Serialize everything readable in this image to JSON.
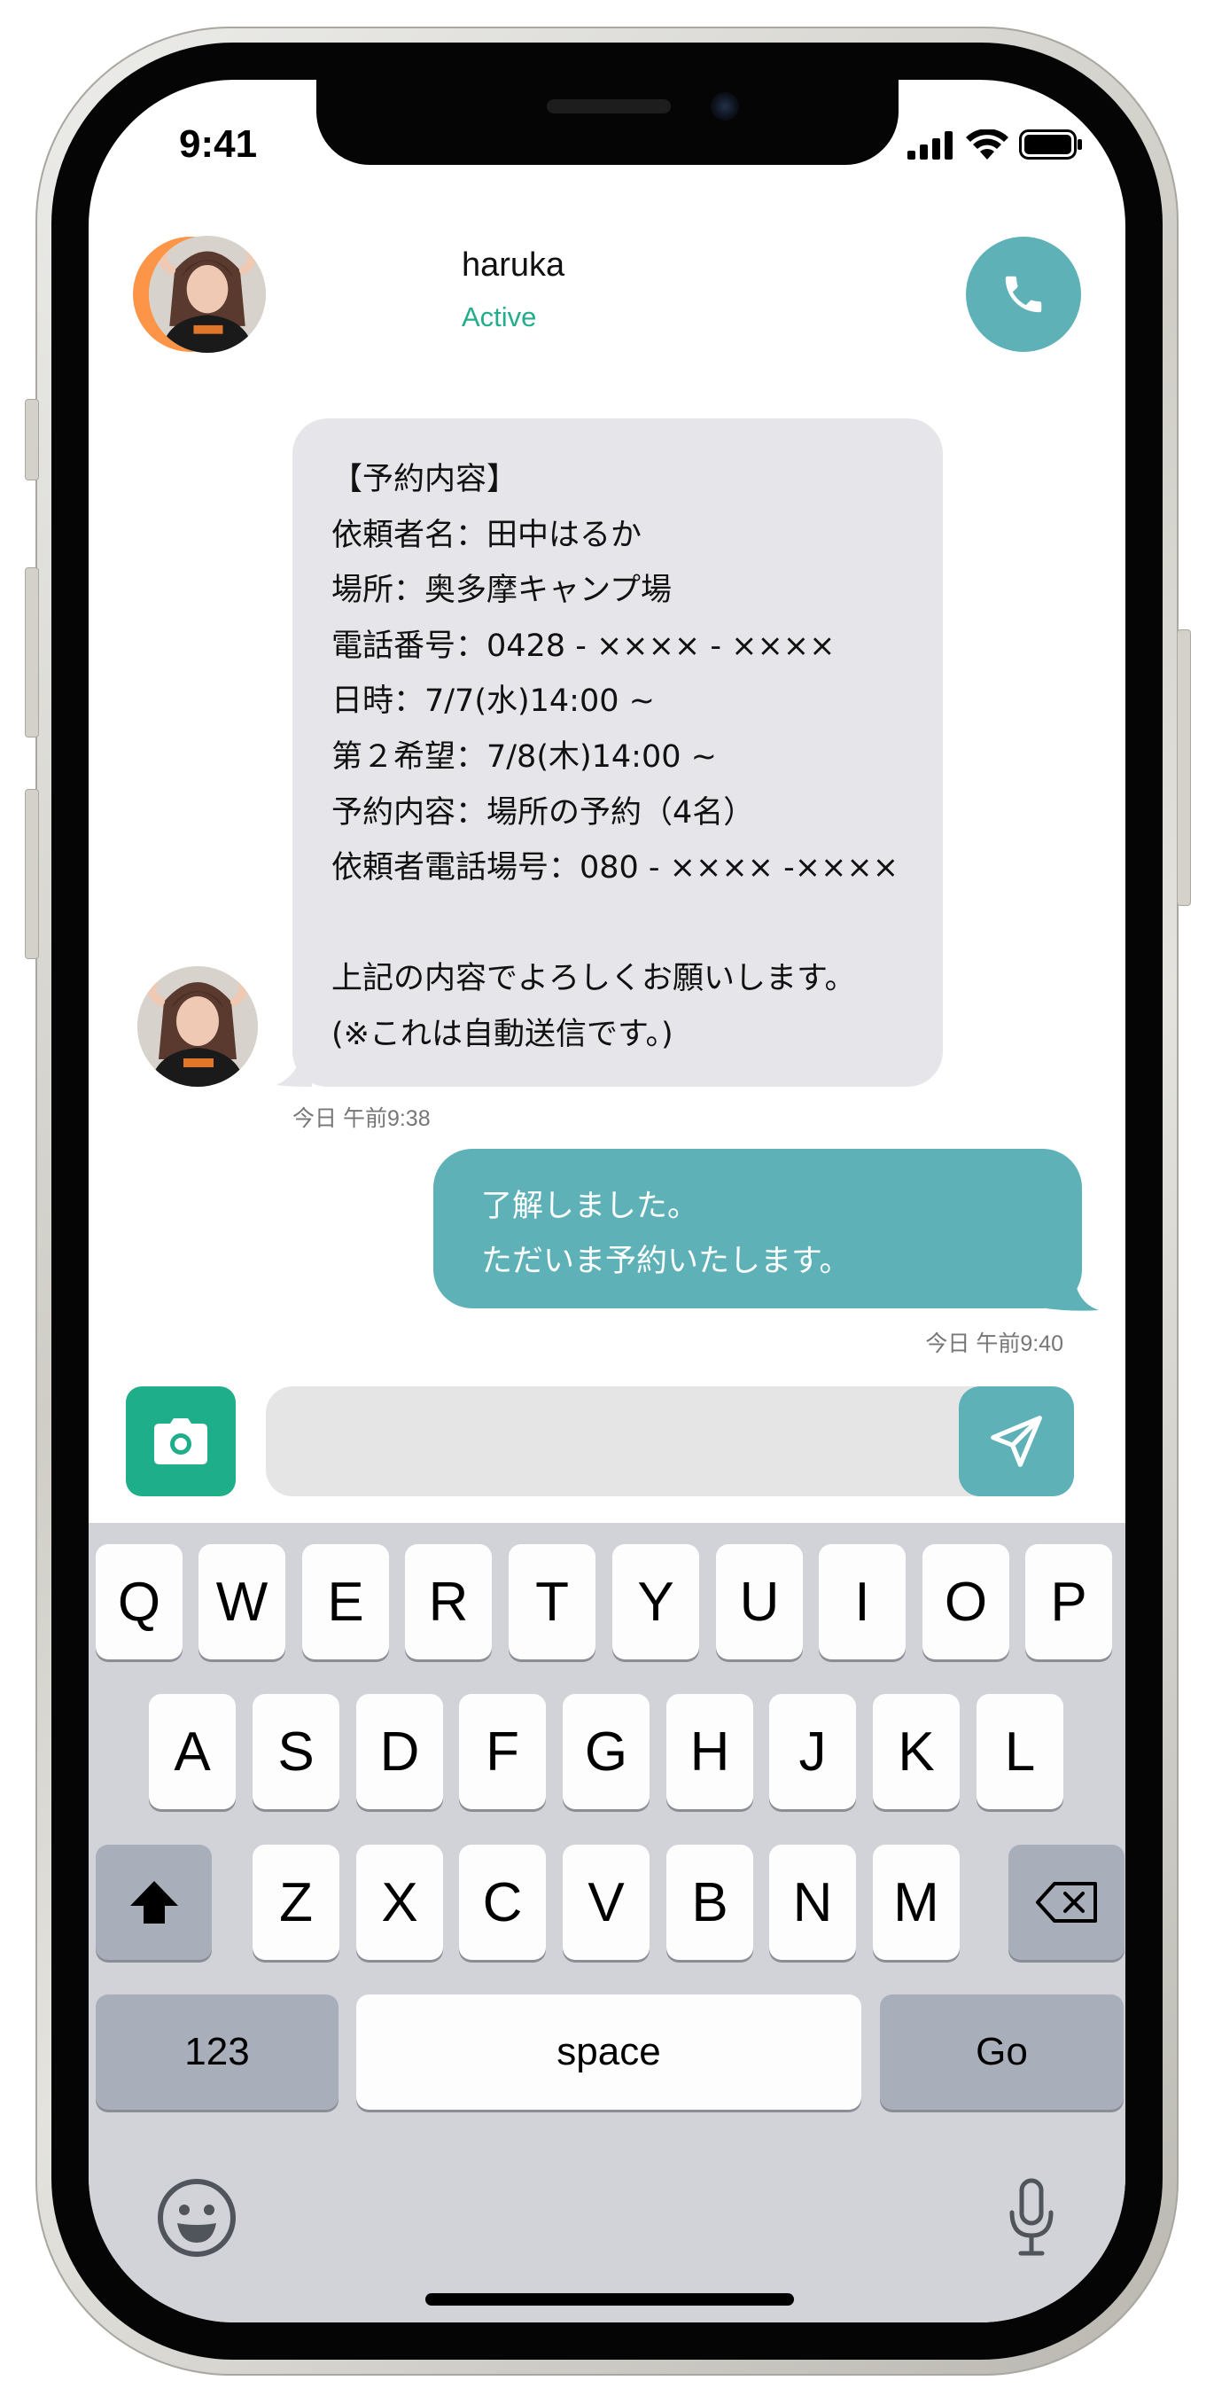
{
  "status_bar": {
    "time": "9:41"
  },
  "header": {
    "name": "haruka",
    "status": "Active"
  },
  "messages": {
    "incoming": {
      "lines": [
        "【予約内容】",
        "依頼者名：田中はるか",
        "場所：奥多摩キャンプ場",
        "電話番号：0428 - ×××× - ××××",
        "日時：7/7(水)14:00 ~",
        "第２希望：7/8(木)14:00 ~",
        "予約内容：場所の予約（4名）",
        "依頼者電話場号：080 - ×××× -××××",
        "",
        "上記の内容でよろしくお願いします。",
        "(※これは自動送信です。)"
      ],
      "timestamp": "今日 午前9:38"
    },
    "outgoing": {
      "lines": [
        "了解しました。",
        "ただいま予約いたします。"
      ],
      "timestamp": "今日 午前9:40"
    }
  },
  "composer": {
    "placeholder": ""
  },
  "keyboard": {
    "row1": [
      "Q",
      "W",
      "E",
      "R",
      "T",
      "Y",
      "U",
      "I",
      "O",
      "P"
    ],
    "row2": [
      "A",
      "S",
      "D",
      "F",
      "G",
      "H",
      "J",
      "K",
      "L"
    ],
    "row3": [
      "Z",
      "X",
      "C",
      "V",
      "B",
      "N",
      "M"
    ],
    "numbers_label": "123",
    "space_label": "space",
    "go_label": "Go"
  },
  "colors": {
    "back_button": "#fd9548",
    "accent_teal": "#5db1b7",
    "camera_button": "#1fae8a",
    "active_green": "#23ad8c",
    "incoming_bubble": "#e5e5ea"
  },
  "icons": [
    "back-chevron-icon",
    "phone-icon",
    "camera-icon",
    "send-icon",
    "shift-icon",
    "backspace-icon",
    "emoji-icon",
    "microphone-icon"
  ]
}
